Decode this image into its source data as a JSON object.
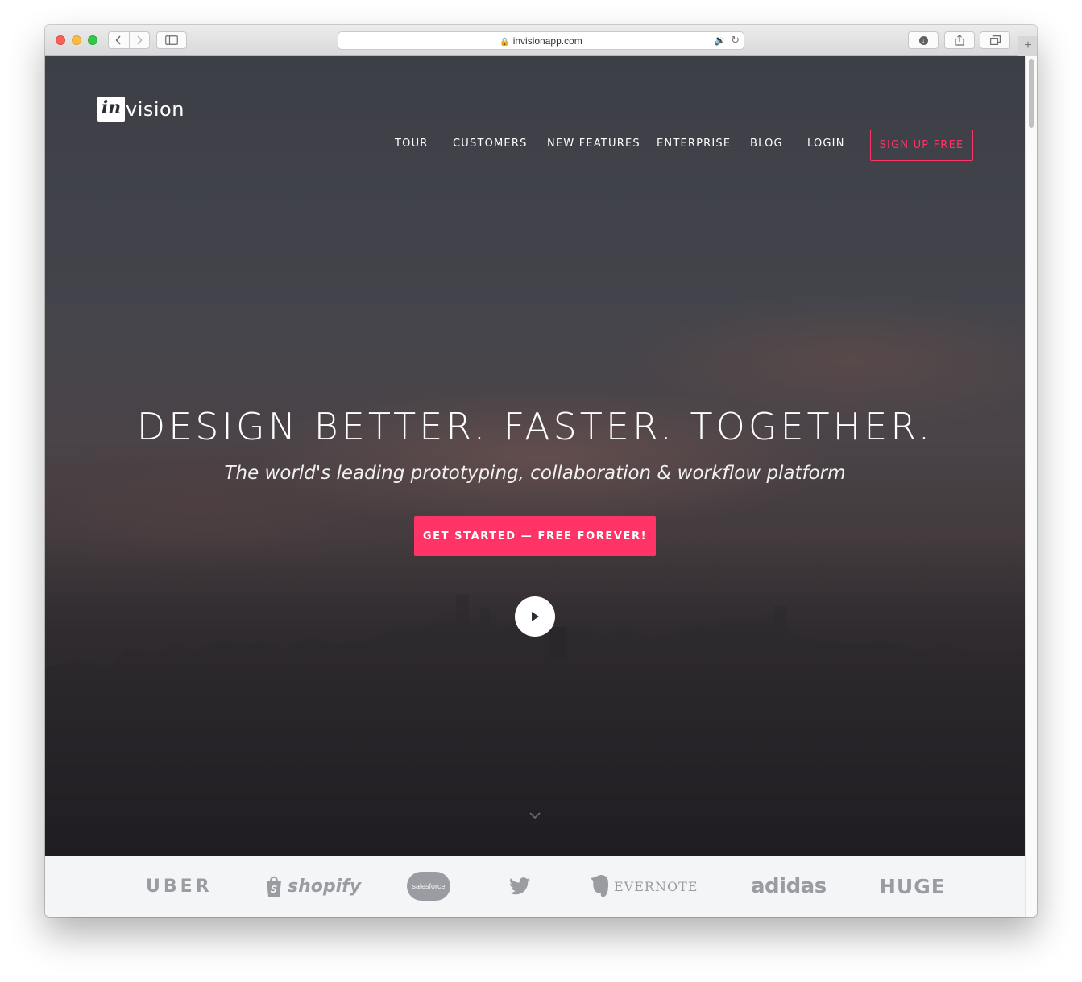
{
  "browser": {
    "url": "invisionapp.com",
    "new_tab_label": "+"
  },
  "header": {
    "logo_mark": "in",
    "logo_word": "vision",
    "nav": [
      "TOUR",
      "CUSTOMERS",
      "NEW FEATURES",
      "ENTERPRISE",
      "BLOG",
      "LOGIN"
    ],
    "signup_label": "SIGN UP FREE"
  },
  "hero": {
    "headline": "DESIGN BETTER. FASTER. TOGETHER.",
    "subheadline": "The world's leading prototyping, collaboration & workflow platform",
    "cta_label": "GET STARTED — FREE FOREVER!"
  },
  "customer_logos": {
    "uber": "UBER",
    "shopify": "shopify",
    "salesforce": "salesforce",
    "evernote": "EVERNOTE",
    "adidas": "adidas",
    "huge": "HUGE"
  },
  "colors": {
    "accent": "#ff3366",
    "hero_dark": "#3d3f47",
    "logo_grey": "#9a9ca2"
  },
  "icons": [
    "back-icon",
    "forward-icon",
    "sidebar-icon",
    "lock-icon",
    "audio-icon",
    "reload-icon",
    "download-icon",
    "share-icon",
    "tabs-icon",
    "play-icon",
    "chevron-down-icon",
    "twitter-bird-icon"
  ]
}
